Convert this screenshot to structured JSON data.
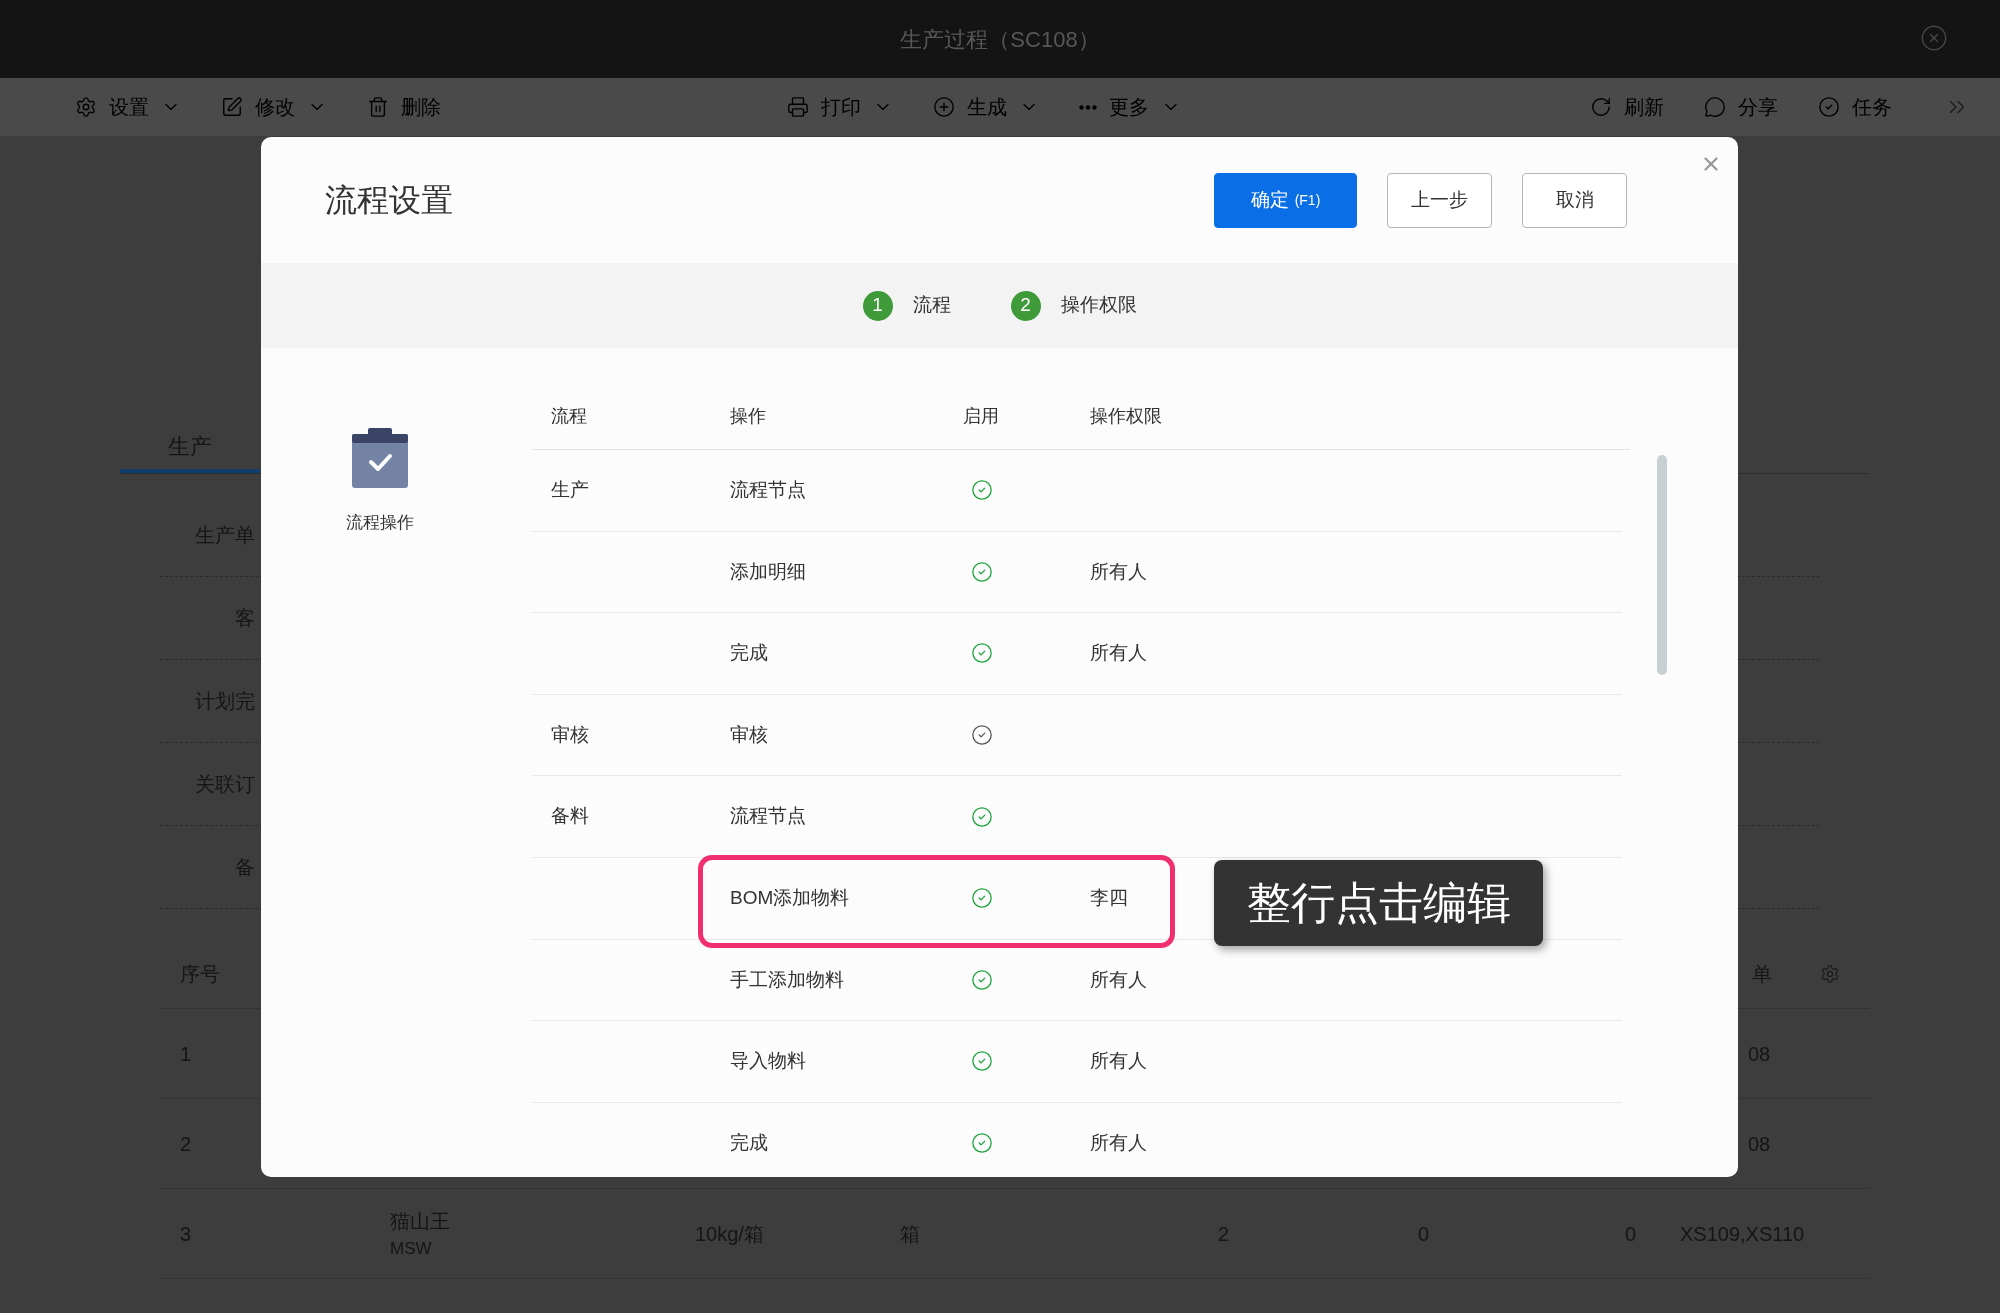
{
  "window": {
    "title": "生产过程（SC108）"
  },
  "toolbar": {
    "left": [
      {
        "label": "设置",
        "dropdown": true
      },
      {
        "label": "修改",
        "dropdown": true
      },
      {
        "label": "删除",
        "dropdown": false
      }
    ],
    "center": [
      {
        "label": "打印",
        "dropdown": true
      },
      {
        "label": "生成",
        "dropdown": true
      },
      {
        "label": "更多",
        "dropdown": true
      }
    ],
    "right": [
      {
        "label": "刷新"
      },
      {
        "label": "分享"
      },
      {
        "label": "任务"
      }
    ]
  },
  "background": {
    "tab": {
      "label": "生产",
      "selected": true
    },
    "form_labels": [
      "生产单",
      "客",
      "计划完",
      "关联订",
      "备"
    ],
    "table": {
      "index_column": "序号",
      "last_column": "单",
      "rows": [
        {
          "index": "1",
          "order": "08"
        },
        {
          "index": "2",
          "order": "08"
        },
        {
          "index": "3",
          "product": "猫山王",
          "product_code": "MSW",
          "spec": "10kg/箱",
          "unit": "箱",
          "column_6": "2",
          "column_7": "0",
          "column_8": "0",
          "order": "XS109,XS110"
        }
      ]
    }
  },
  "dialog": {
    "title": "流程设置",
    "buttons": [
      {
        "label": "确定",
        "shortcut": "(F1)",
        "kind": "primary"
      },
      {
        "label": "上一步",
        "kind": "default"
      },
      {
        "label": "取消",
        "kind": "default"
      }
    ],
    "steps": [
      {
        "number": "1",
        "label": "流程"
      },
      {
        "number": "2",
        "label": "操作权限"
      }
    ],
    "side_item": {
      "label": "流程操作"
    },
    "table": {
      "columns": [
        "流程",
        "操作",
        "启用",
        "操作权限"
      ],
      "rows": [
        {
          "flow": "生产",
          "operation": "流程节点",
          "enabled": true,
          "highlighted": false
        },
        {
          "operation": "添加明细",
          "enabled": true,
          "permission": "所有人",
          "highlighted": false
        },
        {
          "operation": "完成",
          "enabled": true,
          "permission": "所有人",
          "highlighted": false
        },
        {
          "flow": "审核",
          "operation": "审核",
          "enabled": false,
          "highlighted": false
        },
        {
          "flow": "备料",
          "operation": "流程节点",
          "enabled": true,
          "highlighted": false
        },
        {
          "operation": "BOM添加物料",
          "enabled": true,
          "permission": "李四",
          "highlighted": true
        },
        {
          "operation": "手工添加物料",
          "enabled": true,
          "permission": "所有人",
          "highlighted": false
        },
        {
          "operation": "导入物料",
          "enabled": true,
          "permission": "所有人",
          "highlighted": false
        },
        {
          "operation": "完成",
          "enabled": true,
          "permission": "所有人",
          "highlighted": false
        }
      ]
    },
    "callout": "整行点击编辑"
  }
}
